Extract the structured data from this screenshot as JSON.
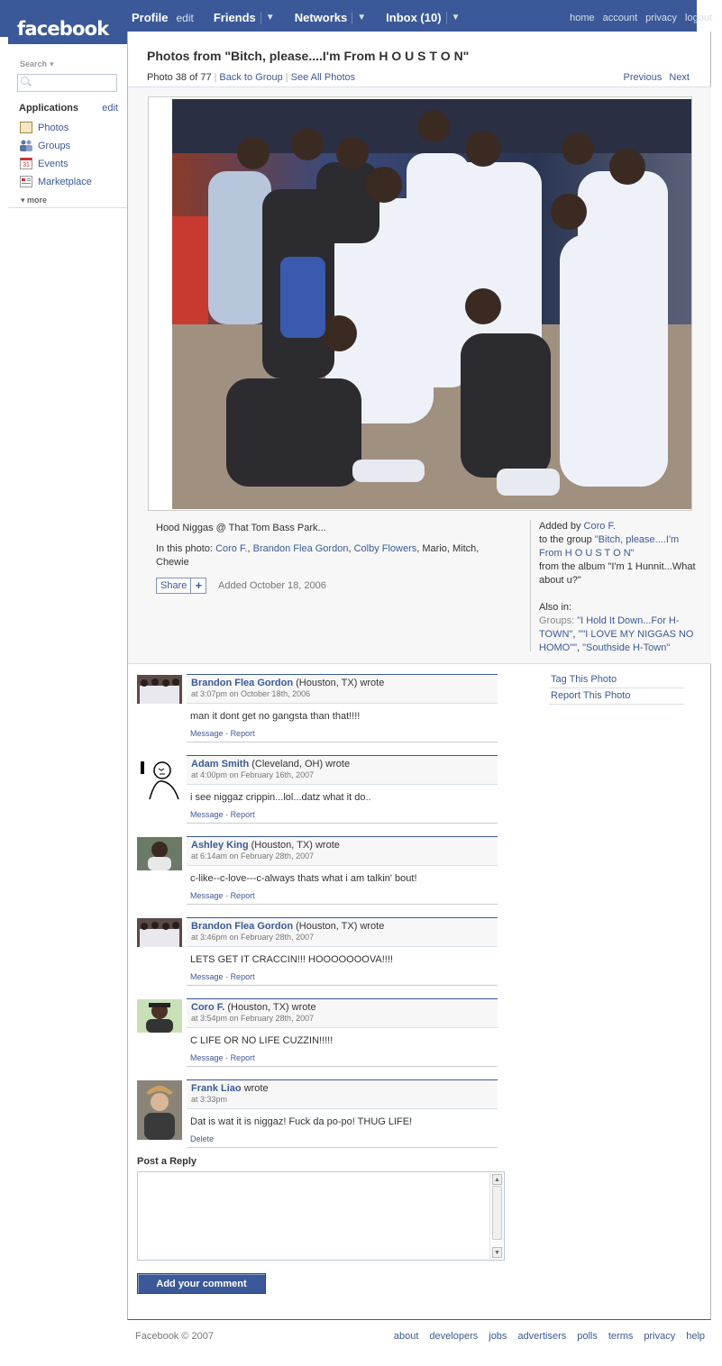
{
  "brand": {
    "logo": "facebook",
    "color": "#3b5998"
  },
  "nav": {
    "profile": "Profile",
    "profile_edit": "edit",
    "friends": "Friends",
    "networks": "Networks",
    "inbox": "Inbox (10)",
    "right": [
      "home",
      "account",
      "privacy",
      "logout"
    ]
  },
  "sidebar": {
    "search_label": "Search",
    "applications_label": "Applications",
    "applications_edit": "edit",
    "apps": [
      "Photos",
      "Groups",
      "Events",
      "Marketplace"
    ],
    "events_icon_text": "31",
    "more": "more"
  },
  "photo": {
    "title": "Photos from \"Bitch, please....I'm From H O U S T O N\"",
    "counter": "Photo 38 of 77",
    "back_to_group": "Back to Group",
    "see_all": "See All Photos",
    "previous": "Previous",
    "next": "Next",
    "caption": "Hood Niggas @ That Tom Bass Park...",
    "in_photo_label": "In this photo:",
    "tagged_links": [
      "Coro F.",
      "Brandon Flea Gordon",
      "Colby Flowers"
    ],
    "tagged_plain": "Mario, Mitch, Chewie",
    "share": "Share",
    "added_date": "Added October 18, 2006"
  },
  "added_by": {
    "label": "Added by",
    "user": "Coro F.",
    "group_prefix": "to the group",
    "group": "\"Bitch, please....I'm From H O U S T O N\"",
    "album": "from the album \"I'm 1 Hunnit...What about u?\"",
    "also_in": "Also in:",
    "groups_label": "Groups:",
    "group_1": "\"I Hold It Down...For H-TOWN\"",
    "group_2": "\"\"I LOVE MY NIGGAS NO HOMO\"\"",
    "group_3": "\"Southside H-Town\""
  },
  "side_links": [
    "Tag This Photo",
    "Report This Photo"
  ],
  "comments": [
    {
      "name": "Brandon Flea Gordon",
      "loc": "(Houston, TX) wrote",
      "time": "at 3:07pm on October 18th, 2006",
      "text": "man it dont get no gangsta than that!!!!",
      "actions": [
        "Message",
        "Report"
      ]
    },
    {
      "name": "Adam Smith",
      "loc": "(Cleveland, OH) wrote",
      "time": "at 4:00pm on February 16th, 2007",
      "text": "i see niggaz crippin...lol...datz what it do..",
      "actions": [
        "Message",
        "Report"
      ]
    },
    {
      "name": "Ashley King",
      "loc": "(Houston, TX) wrote",
      "time": "at 6:14am on February 28th, 2007",
      "text": "c-like--c-love---c-always thats what i am talkin' bout!",
      "actions": [
        "Message",
        "Report"
      ]
    },
    {
      "name": "Brandon Flea Gordon",
      "loc": "(Houston, TX) wrote",
      "time": "at 3:46pm on February 28th, 2007",
      "text": "LETS GET IT CRACCIN!!! HOOOOOOOVA!!!!",
      "actions": [
        "Message",
        "Report"
      ]
    },
    {
      "name": "Coro F.",
      "loc": "(Houston, TX) wrote",
      "time": "at 3:54pm on February 28th, 2007",
      "text": "C LIFE OR NO LIFE CUZZIN!!!!!",
      "actions": [
        "Message",
        "Report"
      ]
    },
    {
      "name": "Frank Liao",
      "loc": "wrote",
      "time": "at 3:33pm",
      "text": "Dat is wat it is niggaz! Fuck da po-po! THUG LIFE!",
      "actions": [
        "Delete"
      ]
    }
  ],
  "reply": {
    "label": "Post a Reply",
    "button": "Add your comment"
  },
  "footer": {
    "copyright": "Facebook © 2007",
    "links": [
      "about",
      "developers",
      "jobs",
      "advertisers",
      "polls",
      "terms",
      "privacy",
      "help"
    ]
  }
}
